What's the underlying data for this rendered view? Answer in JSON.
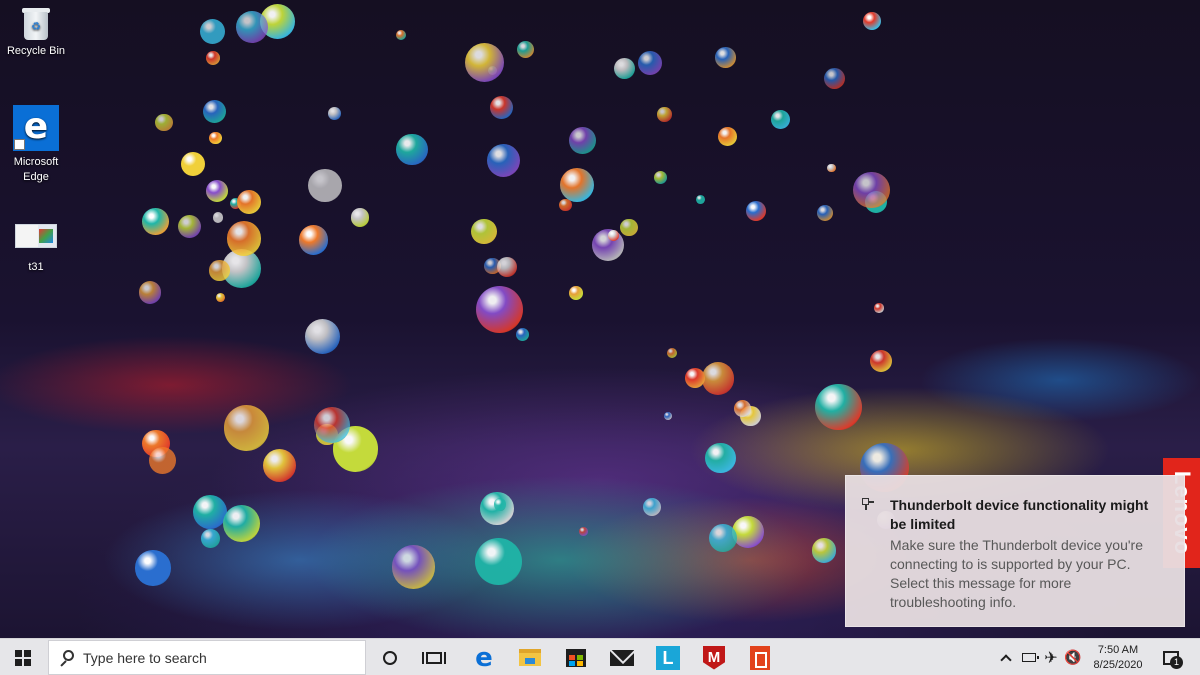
{
  "desktop": {
    "icons": [
      {
        "label": "Recycle Bin",
        "icon": "recycle-bin-icon"
      },
      {
        "label": "Microsoft Edge",
        "icon": "edge-icon"
      },
      {
        "label": "t31",
        "icon": "image-file-icon"
      }
    ],
    "oem_tab": "Lenovo"
  },
  "toast": {
    "icon": "thunderbolt-device-icon",
    "title": "Thunderbolt device functionality might be limited",
    "body": "Make sure the Thunderbolt device you're connecting to is supported by your PC. Select this message for more troubleshooting info."
  },
  "taskbar": {
    "search_placeholder": "Type here to search",
    "pinned_apps": [
      {
        "name": "Microsoft Edge",
        "icon": "edge-icon",
        "glyph": "e"
      },
      {
        "name": "File Explorer",
        "icon": "folder-icon"
      },
      {
        "name": "Microsoft Store",
        "icon": "store-bag-icon"
      },
      {
        "name": "Mail",
        "icon": "mail-icon"
      },
      {
        "name": "Lenovo Vantage",
        "icon": "lenovo-l-icon",
        "glyph": "L"
      },
      {
        "name": "McAfee",
        "icon": "mcafee-shield-icon",
        "glyph": "M"
      },
      {
        "name": "Office",
        "icon": "office-icon"
      }
    ],
    "tray": {
      "time": "7:50 AM",
      "date": "8/25/2020",
      "notification_count": "1",
      "icons": [
        "chevron-up-icon",
        "battery-icon",
        "airplane-mode-icon",
        "volume-muted-icon"
      ]
    }
  },
  "colors": {
    "taskbar_bg": "#e6e6e9",
    "toast_bg": "#e8dee1",
    "edge_blue": "#0a6fd6",
    "lenovo_red": "#e1251b"
  }
}
